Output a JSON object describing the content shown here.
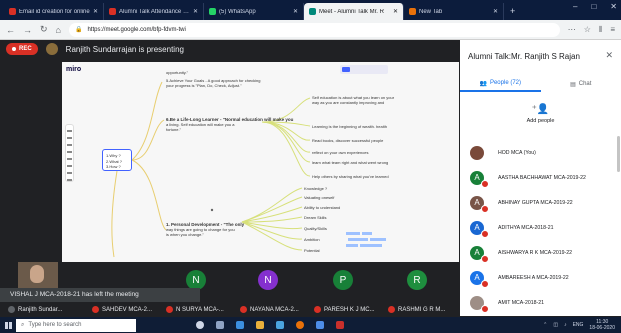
{
  "browser": {
    "tabs": [
      {
        "label": "Email id creation for online",
        "fav_color": "#d93025"
      },
      {
        "label": "Alumni Talk Attendance URL",
        "fav_color": "#d93025"
      },
      {
        "label": "(5) WhatsApp",
        "fav_color": "#25d366"
      },
      {
        "label": "Meet - Alumni Talk Mr. R",
        "fav_color": "#00897b",
        "active": true
      },
      {
        "label": "New Tab",
        "fav_color": "#e8710a"
      }
    ],
    "new_tab": "+",
    "url": "https://meet.google.com/bfp-fdvm-twi"
  },
  "meet": {
    "rec_label": "REC",
    "presenter_text": "Ranjith Sundarrajan is presenting",
    "board": {
      "logo": "miro",
      "hub_lines": [
        "1.Why ?",
        "2.What ?",
        "3.How ?"
      ],
      "nodes": [
        {
          "text": "opportunity.\""
        },
        {
          "text": "5.Achieve Your Goals - A good approach for checking"
        },
        {
          "text": "your progress is \"Plan, Do, Check, Adjust.\""
        },
        {
          "text": "6.Be a Life-Long Learner - \"Normal education will make you",
          "bold": true
        },
        {
          "text": "a living. Self education will make you a"
        },
        {
          "text": "fortune.\""
        },
        {
          "text": "Self education is about what you learn on your"
        },
        {
          "text": "way as you are constantly improving and"
        },
        {
          "text": "Learning is the beginning of wealth. health"
        },
        {
          "text": "Read books, discover successful people"
        },
        {
          "text": "reflect on your own experiences"
        },
        {
          "text": "learn what team right and what went wrong"
        },
        {
          "text": "Help others by sharing what you've learned"
        },
        {
          "text": "1. Personal Development - \"The only",
          "bold": true
        },
        {
          "text": "way things are going to change for you"
        },
        {
          "text": "is when you change.\""
        },
        {
          "text": "Knowledge ?"
        },
        {
          "text": "Valuating oneself"
        },
        {
          "text": "Ability to understand"
        },
        {
          "text": "Dream Skills"
        },
        {
          "text": "Quality/Skills"
        },
        {
          "text": "Ambition"
        },
        {
          "text": "Potential"
        }
      ]
    },
    "notice": "VISHAL J MCA-2018-21 has left the meeting",
    "tiles": [
      {
        "initial": "N",
        "color": "#188038"
      },
      {
        "initial": "N",
        "color": "#8430ce"
      },
      {
        "initial": "P",
        "color": "#188038"
      },
      {
        "initial": "R",
        "color": "#1e8e3e"
      }
    ],
    "names": [
      "Ranjith Sundar...",
      "SAHDEV MCA-2...",
      "N SURYA MCA-...",
      "NAYANA MCA-2...",
      "PARESH K J MC...",
      "RASHMI G R M..."
    ]
  },
  "panel": {
    "title": "Alumni Talk:Mr. Ranjith S Rajan",
    "tabs": [
      {
        "label": "People (72)",
        "active": true
      },
      {
        "label": "Chat",
        "active": false
      }
    ],
    "add_people": "Add people",
    "people": [
      {
        "name": "HOD MCA (You)",
        "initial": "",
        "color": "#7a4a3a"
      },
      {
        "name": "AASTHA BACHHAWAT MCA-2019-22",
        "initial": "A",
        "color": "#188038"
      },
      {
        "name": "ABHINAY GUPTA MCA-2019-22",
        "initial": "A",
        "color": "#795548"
      },
      {
        "name": "ADITHYA MCA-2018-21",
        "initial": "A",
        "color": "#1967d2"
      },
      {
        "name": "AISHWARYA R K MCA-2019-22",
        "initial": "A",
        "color": "#188038"
      },
      {
        "name": "AMBAREESH A MCA-2019-22",
        "initial": "A",
        "color": "#1a73e8"
      },
      {
        "name": "AMIT MCA-2018-21",
        "initial": "",
        "color": "#9e8e86"
      }
    ]
  },
  "taskbar": {
    "search_placeholder": "Type here to search",
    "lang": "ENG",
    "time": "11:30",
    "date": "18-06-2020"
  }
}
